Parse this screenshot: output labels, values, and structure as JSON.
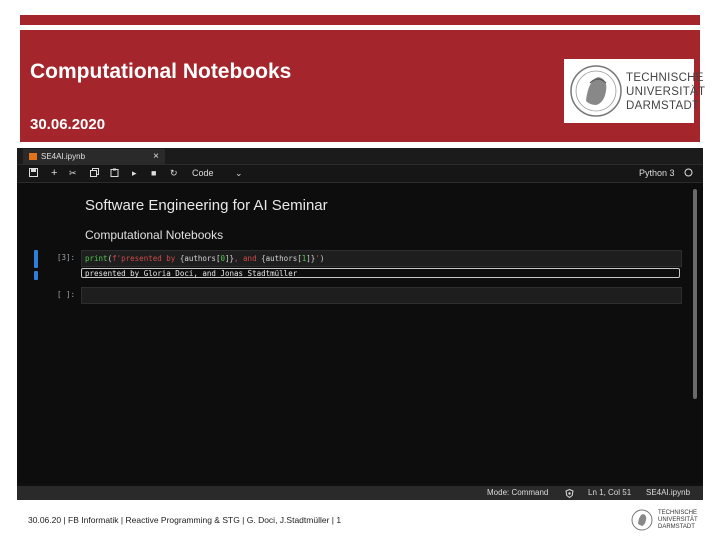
{
  "slide": {
    "title": "Computational Notebooks",
    "date": "30.06.2020",
    "university_logo_text": [
      "TECHNISCHE",
      "UNIVERSITÄT",
      "DARMSTADT"
    ]
  },
  "notebook": {
    "tab_name": "SE4AI.ipynb",
    "tab_close": "×",
    "toolbar": {
      "cell_type": "Code",
      "kernel": "Python 3"
    },
    "heading1": "Software Engineering for AI Seminar",
    "heading2": "Computational Notebooks",
    "cells": [
      {
        "prompt": "[3]:",
        "code_tokens": [
          {
            "text": "print",
            "color": "#4ec94e"
          },
          {
            "text": "(",
            "color": "#d4d4d4"
          },
          {
            "text": "f'presented by ",
            "color": "#cf4a4a"
          },
          {
            "text": "{authors[",
            "color": "#d4d4d4"
          },
          {
            "text": "0",
            "color": "#4ec94e"
          },
          {
            "text": "]}",
            "color": "#d4d4d4"
          },
          {
            "text": ", and ",
            "color": "#cf4a4a"
          },
          {
            "text": "{authors[",
            "color": "#d4d4d4"
          },
          {
            "text": "1",
            "color": "#4ec94e"
          },
          {
            "text": "]}",
            "color": "#d4d4d4"
          },
          {
            "text": "'",
            "color": "#cf4a4a"
          },
          {
            "text": ")",
            "color": "#d4d4d4"
          }
        ],
        "output": "presented by Gloria Doci, and Jonas Stadtmüller"
      },
      {
        "prompt": "[ ]:"
      }
    ],
    "status_bar": {
      "mode": "Mode: Command",
      "position": "Ln 1, Col 51",
      "file": "SE4AI.ipynb"
    }
  },
  "footer": {
    "text": "30.06.20 | FB Informatik | Reactive Programming & STG | G. Doci, J.Stadtmüller | 1",
    "logo_text": [
      "TECHNISCHE",
      "UNIVERSITÄT",
      "DARMSTADT"
    ]
  },
  "colors": {
    "brand_red": "#a4262c",
    "active_cell": "#2f7ed8"
  }
}
